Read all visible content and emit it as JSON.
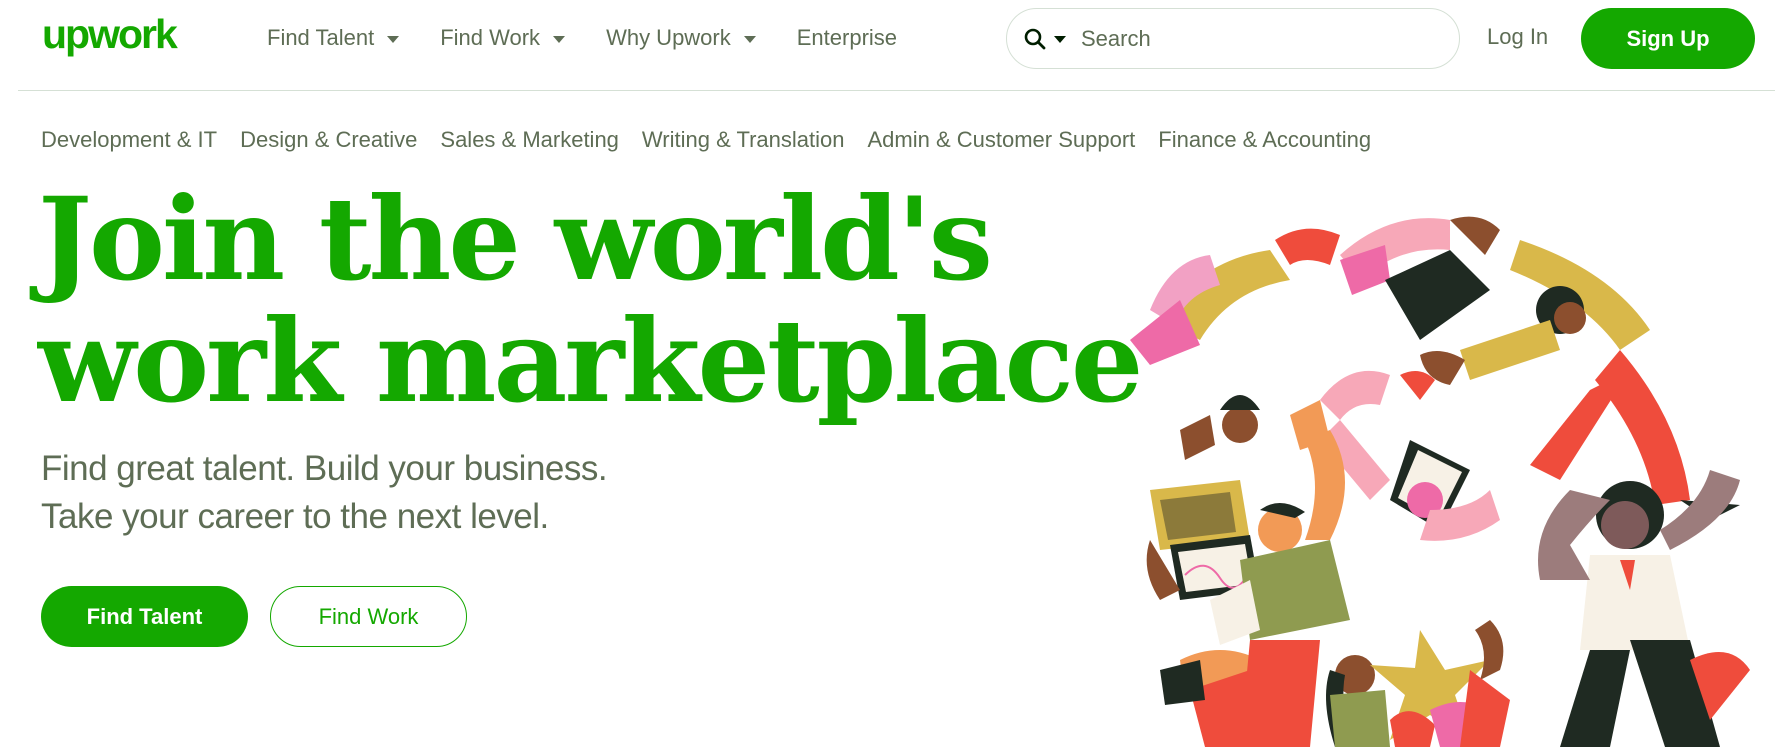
{
  "brand": {
    "logo_text": "upwork",
    "accent": "#14a800",
    "text_muted": "#5e6d55"
  },
  "nav": {
    "items": [
      {
        "label": "Find Talent",
        "has_dropdown": true
      },
      {
        "label": "Find Work",
        "has_dropdown": true
      },
      {
        "label": "Why Upwork",
        "has_dropdown": true
      },
      {
        "label": "Enterprise",
        "has_dropdown": false
      }
    ]
  },
  "search": {
    "placeholder": "Search",
    "icon": "search-icon"
  },
  "auth": {
    "login_label": "Log In",
    "signup_label": "Sign Up"
  },
  "categories": [
    "Development & IT",
    "Design & Creative",
    "Sales & Marketing",
    "Writing & Translation",
    "Admin & Customer Support",
    "Finance & Accounting"
  ],
  "hero": {
    "headline_line1": "Join the world's",
    "headline_line2": "work marketplace",
    "subtitle_line1": "Find great talent. Build your business.",
    "subtitle_line2": "Take your career to the next level.",
    "primary_cta": "Find Talent",
    "secondary_cta": "Find Work"
  }
}
